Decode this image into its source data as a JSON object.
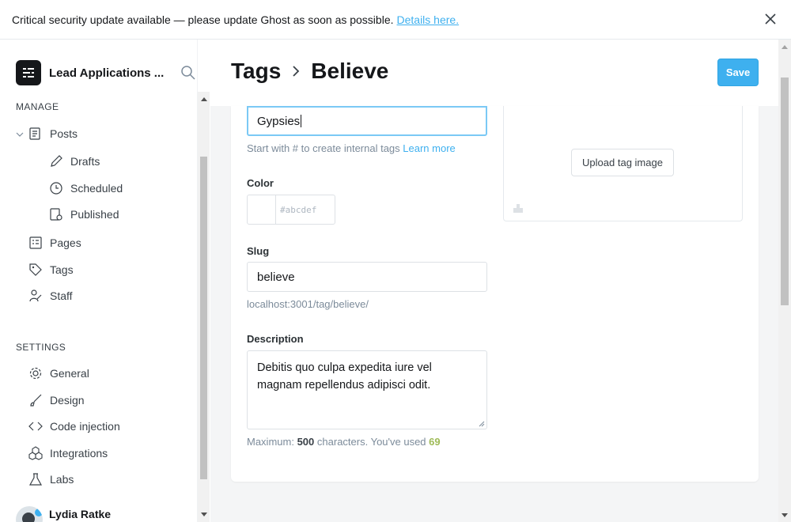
{
  "banner": {
    "message": "Critical security update available — please update Ghost as soon as possible.",
    "link": "Details here."
  },
  "sidebar": {
    "site_title": "Lead Applications ...",
    "manage_label": "MANAGE",
    "settings_label": "SETTINGS",
    "posts": "Posts",
    "drafts": "Drafts",
    "scheduled": "Scheduled",
    "published": "Published",
    "pages": "Pages",
    "tags": "Tags",
    "staff": "Staff",
    "general": "General",
    "design": "Design",
    "code_injection": "Code injection",
    "integrations": "Integrations",
    "labs": "Labs",
    "user_name": "Lydia Ratke"
  },
  "header": {
    "crumb_parent": "Tags",
    "crumb_current": "Believe",
    "save": "Save"
  },
  "form": {
    "name_value": "Gypsies",
    "name_hint": "Start with # to create internal tags",
    "name_hint_link": "Learn more",
    "color_label": "Color",
    "color_placeholder": "abcdef",
    "color_hash": "#",
    "slug_label": "Slug",
    "slug_value": "believe",
    "slug_url": "localhost:3001/tag/believe/",
    "description_label": "Description",
    "description_value": "Debitis quo culpa expedita iure vel magnam repellendus adipisci odit.",
    "max_prefix": "Maximum:",
    "max_value": "500",
    "max_mid": "characters. You've used",
    "used_value": "69",
    "upload_label": "Upload tag image"
  },
  "colors": {
    "accent": "#3eb0ef",
    "used_count": "#9fbb58"
  }
}
